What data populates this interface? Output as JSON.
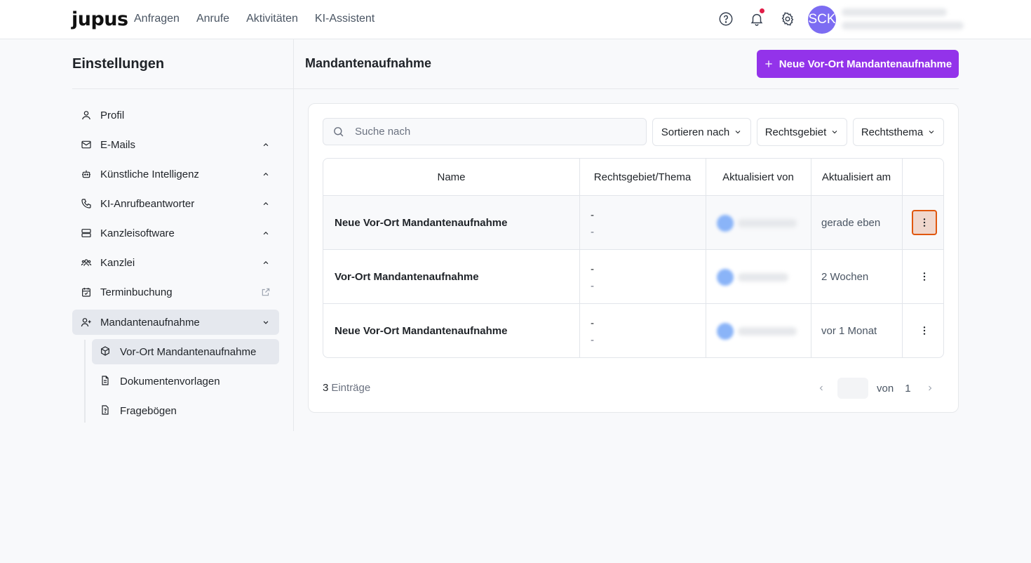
{
  "app": {
    "logo": "jupus"
  },
  "nav": [
    "Anfragen",
    "Anrufe",
    "Aktivitäten",
    "KI-Assistent"
  ],
  "user": {
    "initials": "SCK"
  },
  "sidebar": {
    "title": "Einstellungen",
    "items": [
      {
        "label": "Profil",
        "icon": "user-icon",
        "chevron": ""
      },
      {
        "label": "E-Mails",
        "icon": "mail-icon",
        "chevron": "up"
      },
      {
        "label": "Künstliche Intelligenz",
        "icon": "robot-icon",
        "chevron": "up"
      },
      {
        "label": "KI-Anrufbeantworter",
        "icon": "phone-icon",
        "chevron": "up"
      },
      {
        "label": "Kanzleisoftware",
        "icon": "server-icon",
        "chevron": "up"
      },
      {
        "label": "Kanzlei",
        "icon": "team-icon",
        "chevron": "up"
      },
      {
        "label": "Terminbuchung",
        "icon": "calendar-check-icon",
        "chevron": "external"
      },
      {
        "label": "Mandantenaufnahme",
        "icon": "user-plus-icon",
        "chevron": "down"
      }
    ],
    "subitems": [
      {
        "label": "Vor-Ort Mandantenaufnahme",
        "icon": "box-icon"
      },
      {
        "label": "Dokumentenvorlagen",
        "icon": "document-icon"
      },
      {
        "label": "Fragebögen",
        "icon": "question-file-icon"
      }
    ]
  },
  "main": {
    "title": "Mandantenaufnahme",
    "new_button": "Neue Vor-Ort Mandantenaufnahme"
  },
  "toolbar": {
    "search_placeholder": "Suche nach",
    "sort_label": "Sortieren nach",
    "area_label": "Rechtsgebiet",
    "topic_label": "Rechtsthema"
  },
  "table": {
    "headers": [
      "Name",
      "Rechtsgebiet/Thema",
      "Aktualisiert von",
      "Aktualisiert am"
    ],
    "rows": [
      {
        "name": "Neue Vor-Ort Mandantenaufnahme",
        "area": "-",
        "topic": "-",
        "updated": "gerade eben"
      },
      {
        "name": "Vor-Ort Mandantenaufnahme",
        "area": "-",
        "topic": "-",
        "updated": "2 Wochen"
      },
      {
        "name": "Neue Vor-Ort Mandantenaufnahme",
        "area": "-",
        "topic": "-",
        "updated": "vor 1 Monat"
      }
    ]
  },
  "footer": {
    "count": "3",
    "count_label": "Einträge",
    "of_label": "von",
    "total_pages": "1"
  },
  "colors": {
    "accent": "#9333ea",
    "focus": "#e0570f"
  }
}
